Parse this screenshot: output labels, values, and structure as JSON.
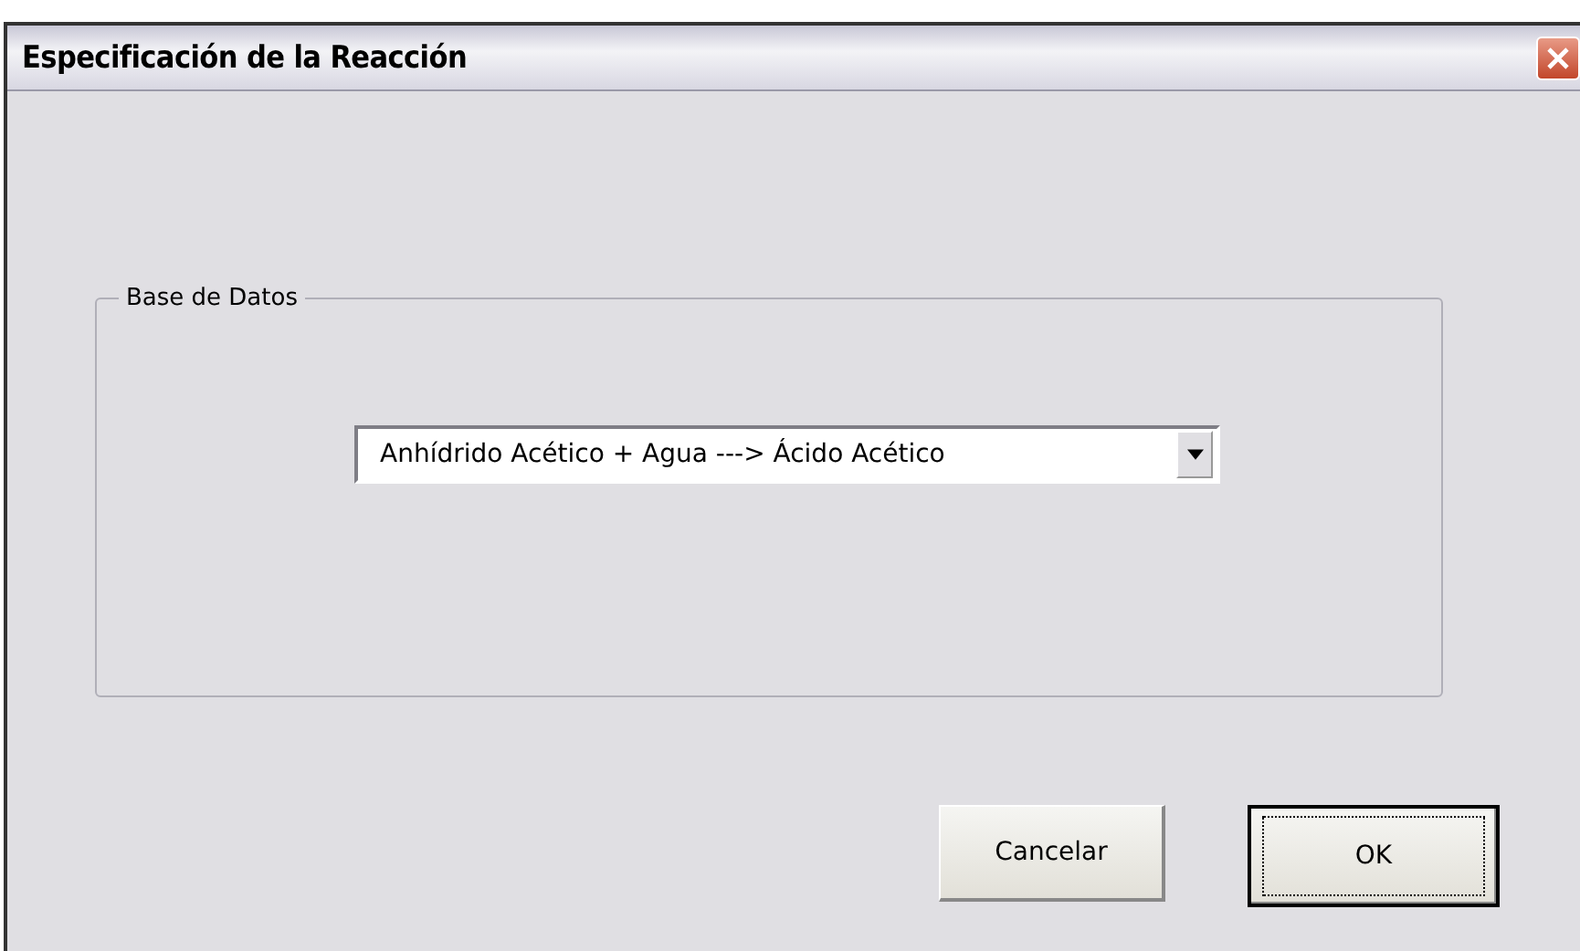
{
  "window": {
    "title": "Especificación de la Reacción"
  },
  "group": {
    "legend": "Base de Datos",
    "dropdown": {
      "value": "Anhídrido Acético + Agua ---> Ácido Acético"
    }
  },
  "buttons": [
    {
      "label": "Cancelar",
      "default": false
    },
    {
      "label": "OK",
      "default": true
    }
  ]
}
